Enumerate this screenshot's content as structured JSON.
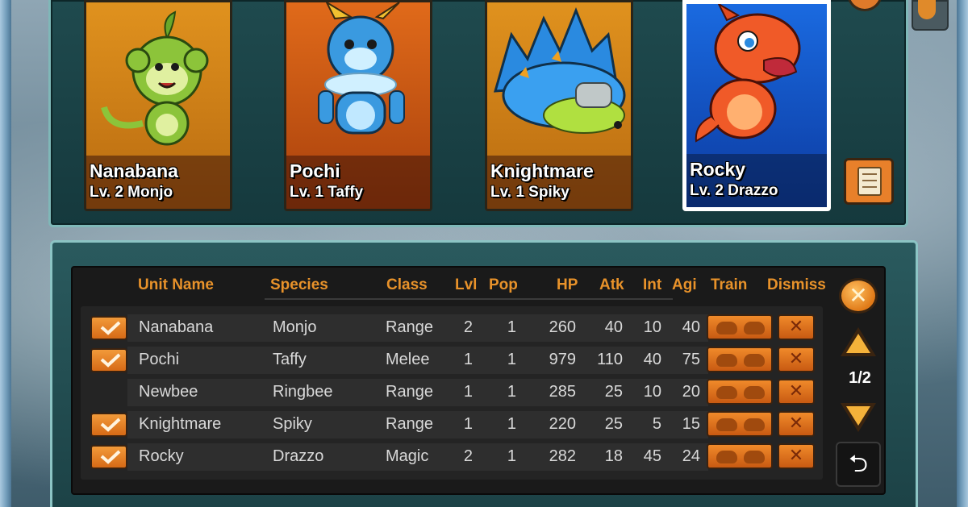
{
  "colors": {
    "accent_orange": "#e8922a",
    "panel_teal": "#1f4a4e",
    "table_bg": "#1a1a1a",
    "text_light": "#d9d9d9"
  },
  "cards": [
    {
      "name": "Nanabana",
      "level": "Lv. 2 Monjo",
      "selected": false,
      "icon": "monkey-creature-icon"
    },
    {
      "name": "Pochi",
      "level": "Lv. 1 Taffy",
      "selected": false,
      "icon": "blue-beast-creature-icon"
    },
    {
      "name": "Knightmare",
      "level": "Lv. 1 Spiky",
      "selected": false,
      "icon": "hedgehog-creature-icon"
    },
    {
      "name": "Rocky",
      "level": "Lv. 2 Drazzo",
      "selected": true,
      "icon": "red-dragon-creature-icon"
    }
  ],
  "table": {
    "headers": {
      "unit_name": "Unit Name",
      "species": "Species",
      "class": "Class",
      "lvl": "Lvl",
      "pop": "Pop",
      "hp": "HP",
      "atk": "Atk",
      "int": "Int",
      "agi": "Agi",
      "train": "Train",
      "dismiss": "Dismiss"
    },
    "rows": [
      {
        "checked": true,
        "name": "Nanabana",
        "species": "Monjo",
        "class": "Range",
        "lvl": "2",
        "pop": "1",
        "hp": "260",
        "atk": "40",
        "int": "10",
        "agi": "40"
      },
      {
        "checked": true,
        "name": "Pochi",
        "species": "Taffy",
        "class": "Melee",
        "lvl": "1",
        "pop": "1",
        "hp": "979",
        "atk": "110",
        "int": "40",
        "agi": "75"
      },
      {
        "checked": false,
        "name": "Newbee",
        "species": "Ringbee",
        "class": "Range",
        "lvl": "1",
        "pop": "1",
        "hp": "285",
        "atk": "25",
        "int": "10",
        "agi": "20"
      },
      {
        "checked": true,
        "name": "Knightmare",
        "species": "Spiky",
        "class": "Range",
        "lvl": "1",
        "pop": "1",
        "hp": "220",
        "atk": "25",
        "int": "5",
        "agi": "15"
      },
      {
        "checked": true,
        "name": "Rocky",
        "species": "Drazzo",
        "class": "Magic",
        "lvl": "2",
        "pop": "1",
        "hp": "282",
        "atk": "18",
        "int": "45",
        "agi": "24"
      }
    ],
    "dismiss_glyph": "✕"
  },
  "pager": {
    "page": "1/2",
    "close_glyph": "✕",
    "return_glyph": "⮌"
  }
}
